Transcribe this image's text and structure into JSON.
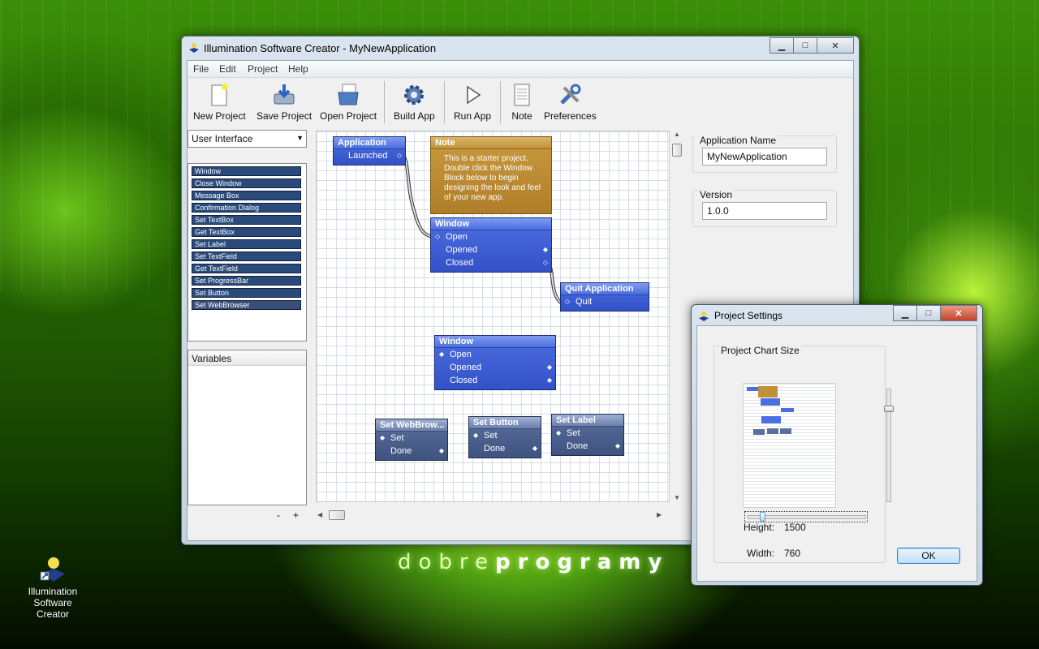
{
  "window": {
    "title": "Illumination Software Creator - MyNewApplication"
  },
  "menu": [
    "File",
    "Edit",
    "Project",
    "Help"
  ],
  "toolbar": [
    {
      "label": "New Project",
      "icon": "new-project-icon"
    },
    {
      "label": "Save Project",
      "icon": "save-project-icon"
    },
    {
      "label": "Open Project",
      "icon": "open-project-icon"
    },
    {
      "label": "Build App",
      "icon": "gear-icon"
    },
    {
      "label": "Run App",
      "icon": "play-icon"
    },
    {
      "label": "Note",
      "icon": "note-icon"
    },
    {
      "label": "Preferences",
      "icon": "tools-icon"
    }
  ],
  "category": {
    "selected": "User Interface"
  },
  "blocks": [
    "Window",
    "Close Window",
    "Message Box",
    "Confirmation Dialog",
    "Set TextBox",
    "Get TextBox",
    "Set Label",
    "Set TextField",
    "Get TextField",
    "Set ProgressBar",
    "Set Button",
    "Set WebBrowser"
  ],
  "variables": {
    "header": "Variables",
    "minus": "-",
    "plus": "+"
  },
  "nodes": {
    "application": {
      "title": "Application",
      "port": "Launched"
    },
    "note": {
      "title": "Note",
      "text": "This is a starter project.  Double click the Window Block below to begin designing the look and feel of your new app."
    },
    "window1": {
      "title": "Window",
      "ports": [
        "Open",
        "Opened",
        "Closed"
      ]
    },
    "quit": {
      "title": "Quit Application",
      "port": "Quit"
    },
    "window2": {
      "title": "Window",
      "ports": [
        "Open",
        "Opened",
        "Closed"
      ]
    },
    "set_webbrowser": {
      "title": "Set WebBrow...",
      "ports": [
        "Set",
        "Done"
      ]
    },
    "set_button": {
      "title": "Set Button",
      "ports": [
        "Set",
        "Done"
      ]
    },
    "set_label": {
      "title": "Set Label",
      "ports": [
        "Set",
        "Done"
      ]
    }
  },
  "properties": {
    "app_name_label": "Application Name",
    "app_name_value": "MyNewApplication",
    "version_label": "Version",
    "version_value": "1.0.0"
  },
  "dialog": {
    "title": "Project Settings",
    "group_title": "Project Chart Size",
    "height_label": "Height:",
    "height_value": "1500",
    "width_label": "Width:",
    "width_value": "760",
    "ok": "OK"
  },
  "desktop": {
    "brand_light": "dobre",
    "brand_bold": "programy",
    "icon_label_1": "Illumination",
    "icon_label_2": "Software Creator"
  },
  "colors": {
    "node_blue": "#3f5fd8",
    "note": "#c0903a",
    "ok_border": "#3a7bc8"
  }
}
